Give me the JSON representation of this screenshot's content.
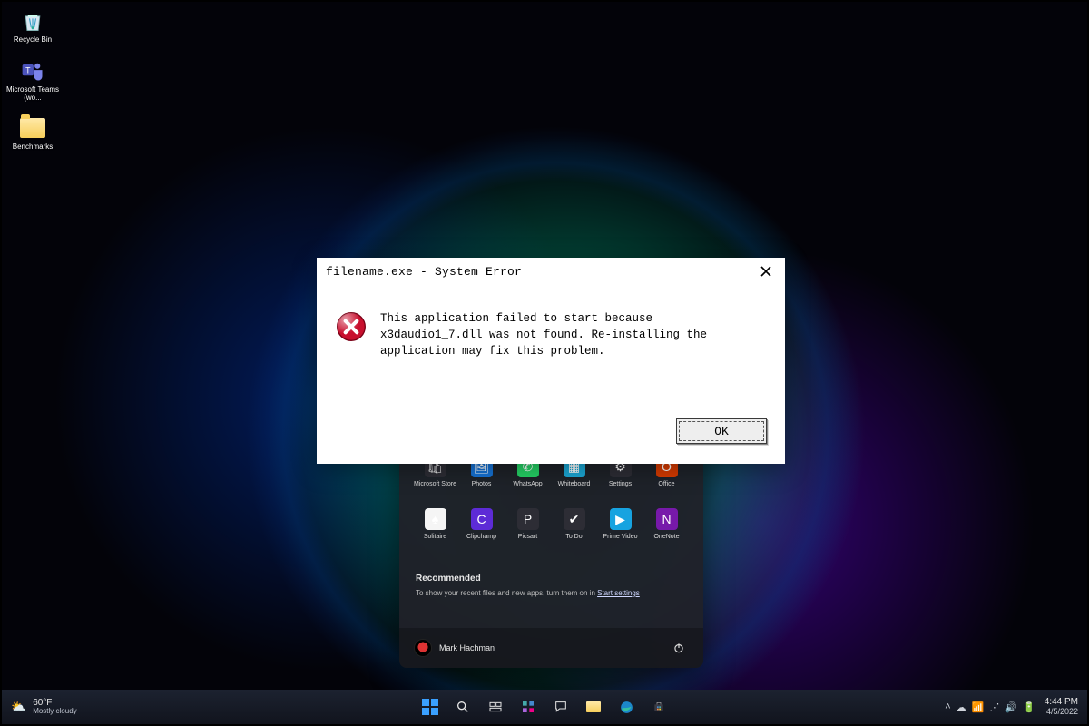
{
  "desktop": {
    "icons": [
      {
        "name": "recycle-bin",
        "label": "Recycle Bin"
      },
      {
        "name": "microsoft-teams",
        "label": "Microsoft Teams (wo..."
      },
      {
        "name": "benchmarks-folder",
        "label": "Benchmarks"
      }
    ]
  },
  "start_menu": {
    "apps_row1": [
      {
        "label": "Microsoft Store",
        "bg": "#2d2d35",
        "glyph": "🛍"
      },
      {
        "label": "Photos",
        "bg": "#1673d6",
        "glyph": "🖼"
      },
      {
        "label": "WhatsApp",
        "bg": "#25d366",
        "glyph": "✆"
      },
      {
        "label": "Whiteboard",
        "bg": "#1ba8d6",
        "glyph": "▦"
      },
      {
        "label": "Settings",
        "bg": "#2d2d35",
        "glyph": "⚙"
      },
      {
        "label": "Office",
        "bg": "#d83b01",
        "glyph": "O"
      }
    ],
    "apps_row2": [
      {
        "label": "Solitaire",
        "bg": "#f5f5f5",
        "glyph": "♠"
      },
      {
        "label": "Clipchamp",
        "bg": "#5d2bd6",
        "glyph": "C"
      },
      {
        "label": "Picsart",
        "bg": "#2d2d35",
        "glyph": "P"
      },
      {
        "label": "To Do",
        "bg": "#2d2d35",
        "glyph": "✔"
      },
      {
        "label": "Prime Video",
        "bg": "#17a3e0",
        "glyph": "▶"
      },
      {
        "label": "OneNote",
        "bg": "#7719aa",
        "glyph": "N"
      }
    ],
    "recommended_heading": "Recommended",
    "recommended_text_prefix": "To show your recent files and new apps, turn them on in ",
    "recommended_link": "Start settings",
    "user_name": "Mark Hachman"
  },
  "dialog": {
    "title": "filename.exe - System Error",
    "message": "This application failed to start because x3daudio1_7.dll was not found. Re-installing the application may fix this problem.",
    "ok_label": "OK"
  },
  "taskbar": {
    "weather_temp": "60°F",
    "weather_cond": "Mostly cloudy",
    "time": "4:44 PM",
    "date": "4/5/2022"
  }
}
